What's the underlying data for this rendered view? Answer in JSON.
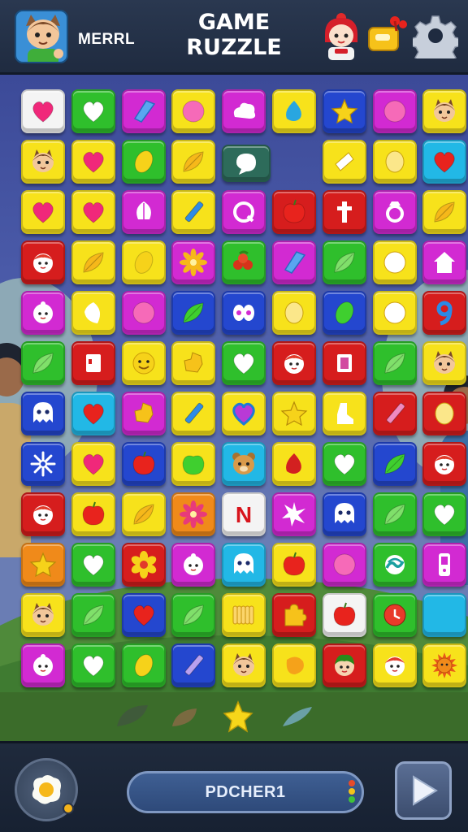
{
  "header": {
    "player_name": "MERRL",
    "title": "GAME\nRUZZLE"
  },
  "footer": {
    "progress_label": "PDCHER1"
  },
  "colors": {
    "yellow": "#f7e21b",
    "green": "#2fbf2c",
    "magenta": "#d22ad2",
    "red": "#d61d1d",
    "blue": "#2447cf",
    "cyan": "#22b8e6",
    "orange": "#f08a1a",
    "white": "#f4f4f4",
    "teal": "#2d6b5a"
  },
  "board": [
    [
      "white:heart",
      "green:heart",
      "magenta:gem",
      "yellow:disc",
      "magenta:cloud",
      "yellow:drop",
      "blue:star",
      "magenta:disc",
      "yellow:cat"
    ],
    [
      "yellow:cat",
      "yellow:heart",
      "green:lemon",
      "yellow:leaf",
      "teal:speech",
      "",
      "yellow:rhombus",
      "yellow:egg",
      "cyan:heart"
    ],
    [
      "yellow:heart",
      "yellow:heart",
      "magenta:bulb",
      "yellow:pencil",
      "magenta:ring",
      "red:apple",
      "red:cross",
      "magenta:ring-gem",
      "yellow:leaf"
    ],
    [
      "red:face",
      "yellow:leaf",
      "yellow:lemon",
      "magenta:flower",
      "green:berries",
      "magenta:gem",
      "green:leaf",
      "yellow:disc-white",
      "magenta:house"
    ],
    [
      "magenta:baby",
      "yellow:diamond",
      "magenta:disc",
      "blue:leaf",
      "blue:butterfly",
      "yellow:egg",
      "blue:lemon",
      "yellow:disc-white",
      "red:nine"
    ],
    [
      "green:leaf",
      "red:square",
      "yellow:smile",
      "yellow:crumb",
      "green:heart",
      "red:face",
      "red:square-pink",
      "green:leaf",
      "yellow:cat"
    ],
    [
      "blue:ghost",
      "cyan:heart",
      "magenta:crumb",
      "yellow:pencil",
      "yellow:heart-blue",
      "yellow:star",
      "yellow:boot",
      "red:pencil",
      "red:egg"
    ],
    [
      "blue:snowflake",
      "yellow:heart",
      "blue:apple",
      "yellow:apple-green",
      "cyan:bear",
      "yellow:drop-red",
      "green:heart",
      "blue:leaf",
      "red:face"
    ],
    [
      "red:face",
      "yellow:apple",
      "yellow:leaf",
      "orange:flower",
      "white:N",
      "magenta:sparkle",
      "blue:ghost",
      "green:leaf",
      "green:heart"
    ],
    [
      "orange:star",
      "green:heart",
      "red:flower-yellow",
      "magenta:baby",
      "cyan:ghost",
      "yellow:apple",
      "magenta:disc",
      "green:wave",
      "magenta:phone"
    ],
    [
      "yellow:cat",
      "green:leaf",
      "blue:heart",
      "green:leaf",
      "yellow:hands",
      "red:puzzle",
      "white:apple",
      "green:clock",
      "cyan:blank"
    ],
    [
      "magenta:baby",
      "green:heart",
      "green:lemon",
      "blue:pencil",
      "yellow:cat",
      "yellow:drop-orange",
      "red:boy",
      "yellow:face",
      "yellow:sun"
    ]
  ]
}
